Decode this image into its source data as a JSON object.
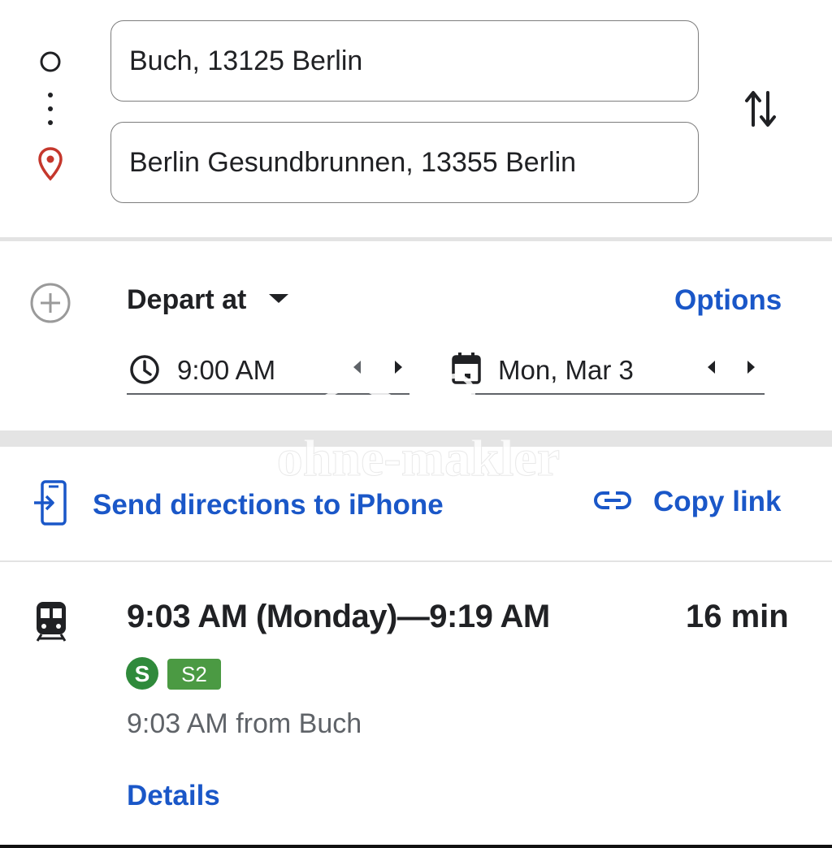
{
  "route": {
    "origin": "Buch, 13125 Berlin",
    "destination": "Berlin Gesundbrunnen, 13355 Berlin",
    "origin_icon": "circle-icon",
    "destination_icon": "location-pin-icon",
    "swap_icon": "swap-vertical-icon"
  },
  "timing": {
    "mode_label": "Depart at",
    "options_label": "Options",
    "time": "9:00 AM",
    "date": "Mon, Mar 3"
  },
  "share": {
    "send_label": "Send directions to iPhone",
    "copy_label": "Copy link"
  },
  "result": {
    "time_range": "9:03 AM (Monday)—9:19 AM",
    "duration": "16 min",
    "line_badge": "S2",
    "departure_info": "9:03 AM from Buch",
    "details_label": "Details"
  },
  "watermark": {
    "text": "ohne-makler"
  },
  "colors": {
    "accent": "#1a57c8",
    "pin": "#c5372c",
    "sbahn_green": "#2f8a3b",
    "badge_green": "#4b9a43"
  }
}
